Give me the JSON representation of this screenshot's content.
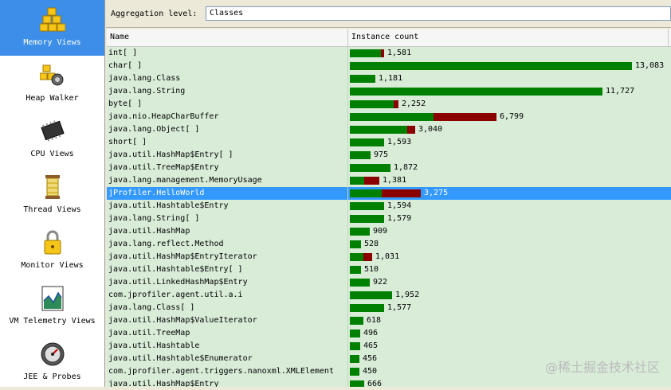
{
  "sidebar": {
    "items": [
      {
        "label": "Memory Views",
        "icon": "memory-views-icon",
        "selected": true
      },
      {
        "label": "Heap Walker",
        "icon": "heap-walker-icon",
        "selected": false
      },
      {
        "label": "CPU Views",
        "icon": "cpu-views-icon",
        "selected": false
      },
      {
        "label": "Thread Views",
        "icon": "thread-views-icon",
        "selected": false
      },
      {
        "label": "Monitor Views",
        "icon": "monitor-views-icon",
        "selected": false
      },
      {
        "label": "VM Telemetry Views",
        "icon": "vm-telemetry-icon",
        "selected": false
      },
      {
        "label": "JEE & Probes",
        "icon": "jee-probes-icon",
        "selected": false
      }
    ]
  },
  "aggregation": {
    "label": "Aggregation level:",
    "value": "Classes"
  },
  "table": {
    "columns": [
      "Name",
      "Instance count"
    ],
    "max_count": 13083,
    "rows": [
      {
        "name": "int[ ]",
        "count": "1,581",
        "value": 1581,
        "red_fraction": 0.1,
        "selected": false
      },
      {
        "name": "char[ ]",
        "count": "13,083",
        "value": 13083,
        "red_fraction": 0,
        "selected": false
      },
      {
        "name": "java.lang.Class",
        "count": "1,181",
        "value": 1181,
        "red_fraction": 0,
        "selected": false
      },
      {
        "name": "java.lang.String",
        "count": "11,727",
        "value": 11727,
        "red_fraction": 0,
        "selected": false
      },
      {
        "name": "byte[ ]",
        "count": "2,252",
        "value": 2252,
        "red_fraction": 0.1,
        "selected": false
      },
      {
        "name": "java.nio.HeapCharBuffer",
        "count": "6,799",
        "value": 6799,
        "red_fraction": 0.43,
        "selected": false
      },
      {
        "name": "java.lang.Object[ ]",
        "count": "3,040",
        "value": 3040,
        "red_fraction": 0.12,
        "selected": false
      },
      {
        "name": "short[ ]",
        "count": "1,593",
        "value": 1593,
        "red_fraction": 0,
        "selected": false
      },
      {
        "name": "java.util.HashMap$Entry[ ]",
        "count": "975",
        "value": 975,
        "red_fraction": 0,
        "selected": false
      },
      {
        "name": "java.util.TreeMap$Entry",
        "count": "1,872",
        "value": 1872,
        "red_fraction": 0,
        "selected": false
      },
      {
        "name": "java.lang.management.MemoryUsage",
        "count": "1,381",
        "value": 1381,
        "red_fraction": 0.5,
        "selected": false
      },
      {
        "name": "jProfiler.HelloWorld",
        "count": "3,275",
        "value": 3275,
        "red_fraction": 0.55,
        "selected": true
      },
      {
        "name": "java.util.Hashtable$Entry",
        "count": "1,594",
        "value": 1594,
        "red_fraction": 0,
        "selected": false
      },
      {
        "name": "java.lang.String[ ]",
        "count": "1,579",
        "value": 1579,
        "red_fraction": 0,
        "selected": false
      },
      {
        "name": "java.util.HashMap",
        "count": "909",
        "value": 909,
        "red_fraction": 0,
        "selected": false
      },
      {
        "name": "java.lang.reflect.Method",
        "count": "528",
        "value": 528,
        "red_fraction": 0,
        "selected": false
      },
      {
        "name": "java.util.HashMap$EntryIterator",
        "count": "1,031",
        "value": 1031,
        "red_fraction": 0.4,
        "selected": false
      },
      {
        "name": "java.util.Hashtable$Entry[ ]",
        "count": "510",
        "value": 510,
        "red_fraction": 0,
        "selected": false
      },
      {
        "name": "java.util.LinkedHashMap$Entry",
        "count": "922",
        "value": 922,
        "red_fraction": 0,
        "selected": false
      },
      {
        "name": "com.jprofiler.agent.util.a.i",
        "count": "1,952",
        "value": 1952,
        "red_fraction": 0,
        "selected": false
      },
      {
        "name": "java.lang.Class[ ]",
        "count": "1,577",
        "value": 1577,
        "red_fraction": 0,
        "selected": false
      },
      {
        "name": "java.util.HashMap$ValueIterator",
        "count": "618",
        "value": 618,
        "red_fraction": 0,
        "selected": false
      },
      {
        "name": "java.util.TreeMap",
        "count": "496",
        "value": 496,
        "red_fraction": 0,
        "selected": false
      },
      {
        "name": "java.util.Hashtable",
        "count": "465",
        "value": 465,
        "red_fraction": 0,
        "selected": false
      },
      {
        "name": "java.util.Hashtable$Enumerator",
        "count": "456",
        "value": 456,
        "red_fraction": 0,
        "selected": false
      },
      {
        "name": "com.jprofiler.agent.triggers.nanoxml.XMLElement",
        "count": "450",
        "value": 450,
        "red_fraction": 0,
        "selected": false
      },
      {
        "name": "java.util.HashMap$Entry",
        "count": "666",
        "value": 666,
        "red_fraction": 0,
        "selected": false
      }
    ]
  },
  "watermark": "@稀土掘金技术社区",
  "colors": {
    "bar_green": "#008000",
    "bar_red": "#8b0000",
    "selection": "#3399ff",
    "sidebar_selected": "#3d8ee8"
  }
}
